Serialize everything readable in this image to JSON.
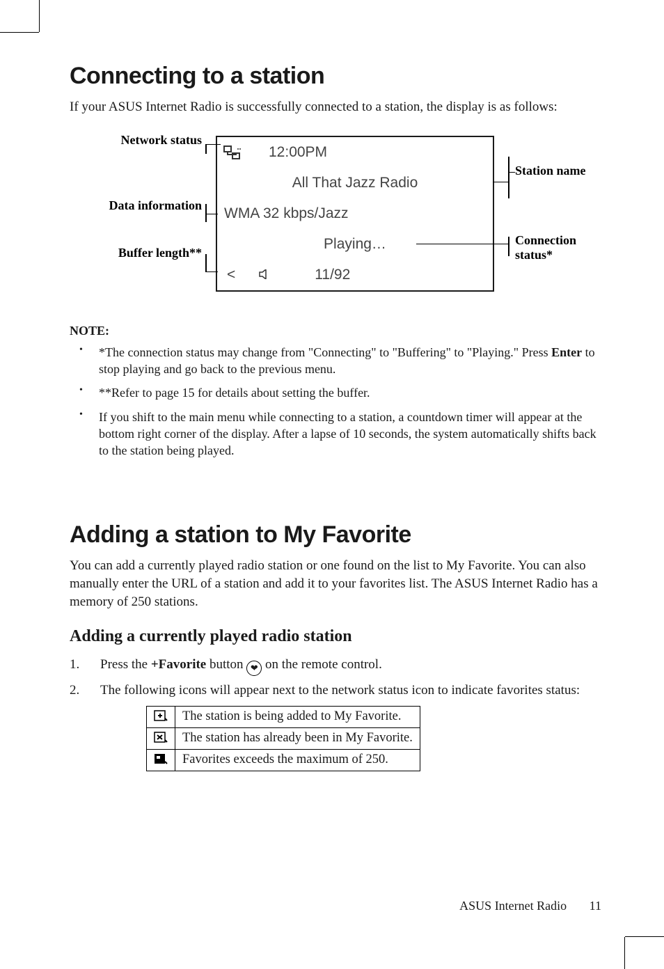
{
  "section1": {
    "heading": "Connecting to a station",
    "intro": "If your ASUS Internet Radio is successfully connected to a station, the display is as follows:",
    "labels": {
      "network_status": "Network status",
      "station_name": "Station name",
      "data_information": "Data information",
      "connection_status": "Connection status*",
      "buffer_length": "Buffer length**"
    },
    "display": {
      "time": "12:00PM",
      "station": "All That Jazz Radio",
      "codec": "WMA 32 kbps/Jazz",
      "status": "Playing…",
      "nav_left": "<",
      "counter": "11/92"
    },
    "note_heading": "NOTE:",
    "notes": [
      "*The connection status may change from \"Connecting\" to \"Buffering\" to \"Playing.\" Press Enter to stop playing and go back to the previous menu.",
      "**Refer to page 15 for details about setting the buffer.",
      "If you shift to the main menu while connecting to a station, a countdown timer will appear at the bottom right corner of the display. After a lapse of 10 seconds, the system automatically shifts back to the station being played."
    ]
  },
  "section2": {
    "heading": "Adding a station to My Favorite",
    "intro": "You can add a currently played radio station or one found on the list to My Favorite. You can also manually enter the URL of a station and add it to your favorites list. The ASUS Internet Radio has a memory of 250 stations.",
    "sub_heading": "Adding a currently played radio station",
    "steps": {
      "s1a": "Press the ",
      "s1b": "+Favorite",
      "s1c": " button ",
      "s1d": " on the remote control.",
      "s2": "The following icons will appear next to the network status icon to indicate favorites status:"
    },
    "table": [
      "The station is being added to My Favorite.",
      "The station has already been in My Favorite.",
      "Favorites exceeds the maximum of 250."
    ]
  },
  "footer": {
    "product": "ASUS Internet Radio",
    "page": "11"
  }
}
